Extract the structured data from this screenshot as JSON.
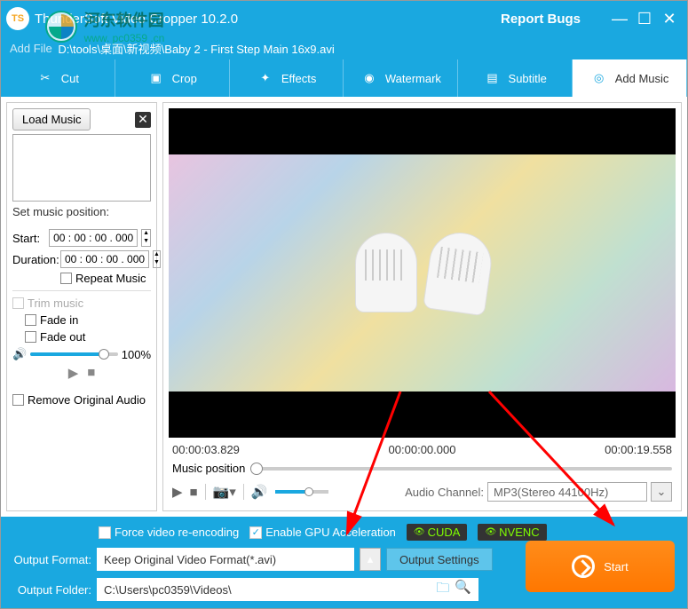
{
  "titlebar": {
    "title": "ThunderSoft Video Cropper 10.2.0",
    "report": "Report Bugs"
  },
  "path": {
    "prefix": "Add File",
    "value": "D:\\tools\\桌面\\新视频\\Baby 2 - First Step Main 16x9.avi"
  },
  "tabs": [
    "Cut",
    "Crop",
    "Effects",
    "Watermark",
    "Subtitle",
    "Add Music"
  ],
  "side": {
    "load": "Load Music",
    "setpos": "Set music position:",
    "start_lbl": "Start:",
    "start_val": "00 : 00 : 00 . 000",
    "dur_lbl": "Duration:",
    "dur_val": "00 : 00 : 00 . 000",
    "repeat": "Repeat Music",
    "trim": "Trim music",
    "fadein": "Fade in",
    "fadeout": "Fade out",
    "vol": "100%",
    "remove": "Remove Original Audio"
  },
  "preview": {
    "t1": "00:00:03.829",
    "t2": "00:00:00.000",
    "t3": "00:00:19.558"
  },
  "muspos": "Music position",
  "audio": {
    "lbl": "Audio Channel:",
    "val": "MP3(Stereo 44100Hz)"
  },
  "opts": {
    "force": "Force video re-encoding",
    "gpu": "Enable GPU Acceleration",
    "cuda": "CUDA",
    "nvenc": "NVENC"
  },
  "out": {
    "fmt_lbl": "Output Format:",
    "fmt_val": "Keep Original Video Format(*.avi)",
    "settings": "Output Settings",
    "fld_lbl": "Output Folder:",
    "fld_val": "C:\\Users\\pc0359\\Videos\\"
  },
  "start": "Start",
  "watermark": {
    "url": "www. pc0359 .cn",
    "name": "河东软件园"
  }
}
